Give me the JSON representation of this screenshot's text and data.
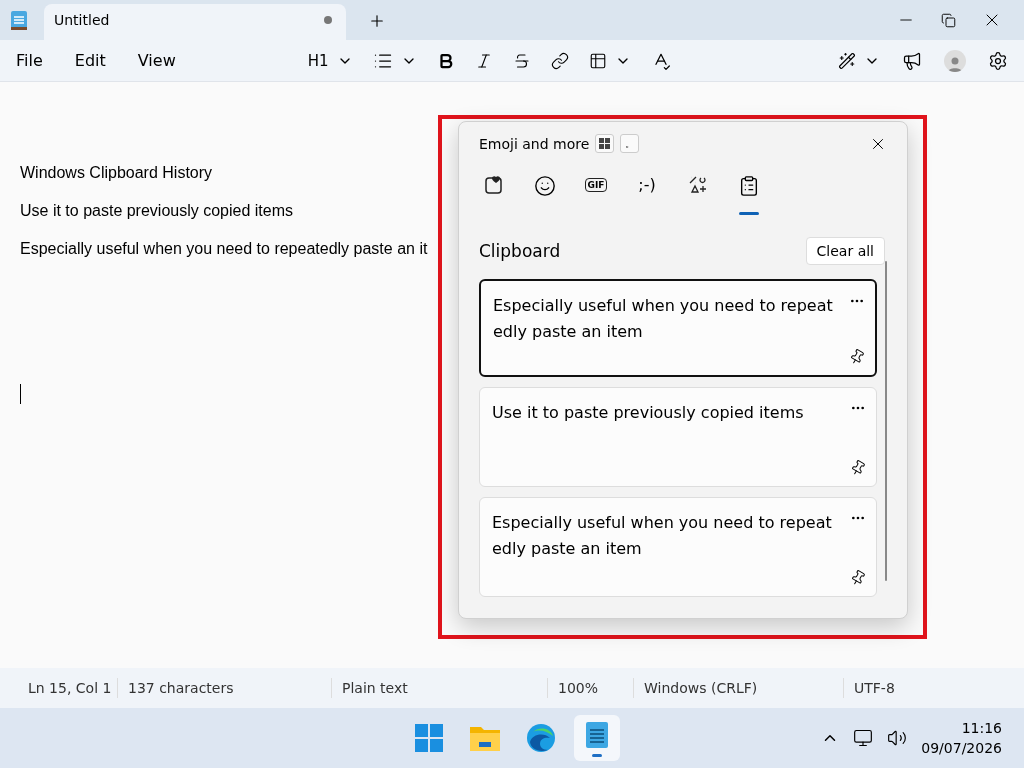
{
  "window": {
    "tab_title": "Untitled",
    "tab_unsaved": true
  },
  "menu": [
    "File",
    "Edit",
    "View"
  ],
  "toolbar": {
    "heading": "H1"
  },
  "document": {
    "lines": [
      "Windows Clipboard History",
      "Use it to paste previously copied items",
      "Especially useful when you need to repeatedly paste an it"
    ]
  },
  "emoji_panel": {
    "title": "Emoji and more",
    "key_hint": "。",
    "tabs": [
      {
        "kind": "favorites",
        "selected": false
      },
      {
        "kind": "emoji",
        "selected": false
      },
      {
        "kind": "gif",
        "label": "GIF",
        "selected": false
      },
      {
        "kind": "kaomoji",
        "label": ";-)",
        "selected": false
      },
      {
        "kind": "symbols",
        "selected": false
      },
      {
        "kind": "clipboard",
        "selected": true
      }
    ],
    "section_title": "Clipboard",
    "clear_button": "Clear all",
    "items": [
      {
        "text": "Especially useful when you need to repeatedly paste an item",
        "selected": true
      },
      {
        "text": "Use it to paste previously copied items",
        "selected": false
      },
      {
        "text": "Especially useful when you need to repeatedly paste an item",
        "selected": false
      }
    ]
  },
  "status_bar": [
    "Ln 15, Col 1",
    "137 characters",
    "Plain text",
    "100%",
    "Windows (CRLF)",
    "UTF-8"
  ],
  "taskbar": {
    "time": "11:16",
    "date": "09/07/2026"
  }
}
